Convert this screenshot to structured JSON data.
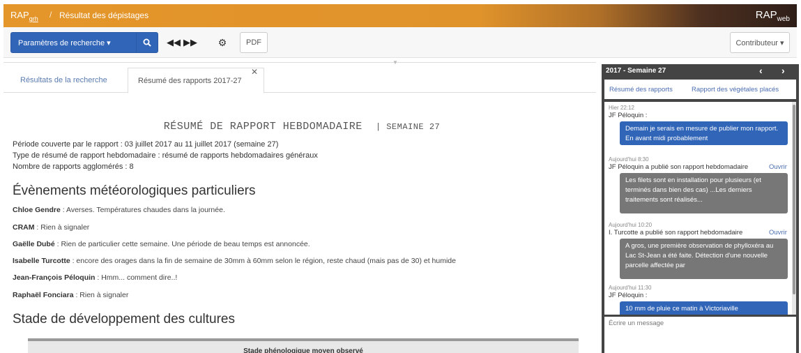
{
  "header": {
    "brand": "RAP",
    "brand_sub": "grh",
    "page_title": "Résultat des dépistages",
    "brand_right": "RAP",
    "brand_right_sub": "web"
  },
  "toolbar": {
    "params_label": "Paramètres de recherche ▾",
    "pdf_label": "PDF",
    "contributor_label": "Contributeur ▾",
    "icons": [
      "search-icon",
      "fast-backward-icon",
      "fast-forward-icon",
      "gear-icon"
    ]
  },
  "tabs": [
    {
      "label": "Résultats de la recherche"
    },
    {
      "label": "Résumé des rapports 2017-27"
    }
  ],
  "doc": {
    "title": "RÉSUMÉ DE RAPPORT HEBDOMADAIRE",
    "week": "| SEMAINE 27",
    "meta": [
      "Période couverte par le rapport : 03 juillet 2017 au 11 juillet 2017 (semaine 27)",
      "Type de résumé de rapport hebdomadaire : résumé de rapports hebdomadaires généraux",
      "Nombre de rapports agglomérés : 8"
    ],
    "events_heading": "Évènements météorologiques particuliers",
    "events": [
      {
        "name": "Chloe Gendre",
        "text": " : Averses. Températures chaudes dans la journée."
      },
      {
        "name": "CRAM",
        "text": " : Rien à signaler"
      },
      {
        "name": "Gaëlle Dubé",
        "text": " : Rien de particulier cette semaine. Une période de beau temps est annoncée."
      },
      {
        "name": "Isabelle Turcotte",
        "text": " : encore des orages dans la fin de semaine de 30mm à 60mm selon le région, reste chaud (mais pas de 30) et humide"
      },
      {
        "name": "Jean-François Péloquin",
        "text": " : Hmm... comment dire..!"
      },
      {
        "name": "Raphaël Fonciara",
        "text": " : Rien à signaler"
      }
    ],
    "stage_heading": "Stade de développement des cultures",
    "stage_table_header": "Stade phénologique moyen observé"
  },
  "panel": {
    "title": "2017 - Semaine 27",
    "tabs": [
      "Résumé des rapports",
      "Rapport des végétales placés"
    ],
    "messages": [
      {
        "time": "Hier 22:12",
        "who": "JF Péloquin :",
        "open": "",
        "text": "Demain je serais en mesure de publier mon rapport. En avant midi probablement",
        "style": "blue"
      },
      {
        "time": "Aujourd'hui 8:30",
        "who": "JF Péloquin a publié son rapport hebdomadaire",
        "open": "Ouvrir",
        "text": "Les filets sont en installation pour plusieurs (et terminés dans bien des cas) ...Les derniers traitements sont réalisés...",
        "style": "gray"
      },
      {
        "time": "Aujourd'hui 10:20",
        "who": "I. Turcotte a publié son rapport hebdomadaire",
        "open": "Ouvrir",
        "text": "A gros, une première observation de phylloxéra au Lac St-Jean a été faite. Détection d'une nouvelle parcelle affectée par",
        "style": "gray"
      },
      {
        "time": "Aujourd'hui 11:30",
        "who": "JF Péloquin :",
        "open": "",
        "text": "10 mm de pluie ce matin à Victoriaville",
        "style": "blue"
      }
    ],
    "input_placeholder": "Écrire un message"
  }
}
